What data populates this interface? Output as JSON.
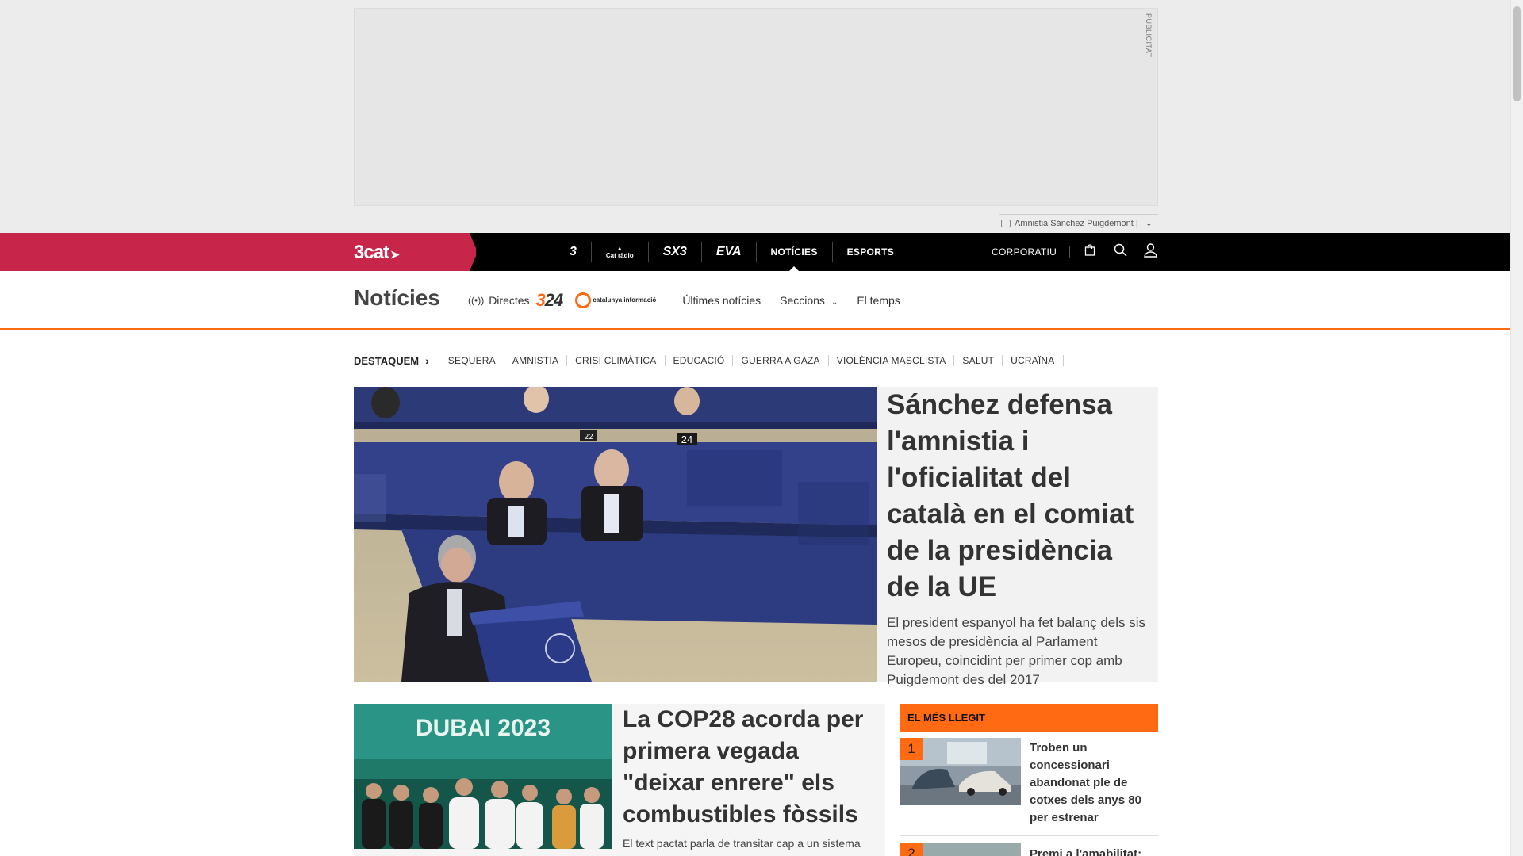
{
  "ad": {
    "label": "PUBLICITAT"
  },
  "tag_bar": {
    "text": "Amnistia Sánchez Puigdemont |",
    "chevron": "⌄"
  },
  "topbar": {
    "brand": "3cat",
    "channels": [
      {
        "label": "3",
        "kind": "tv3-logo"
      },
      {
        "label": "Cat ràdio",
        "kind": "catradio-logo"
      },
      {
        "label": "SX3",
        "kind": "sx3-logo"
      },
      {
        "label": "EVA",
        "kind": "eva-logo"
      },
      {
        "label": "NOTÍCIES",
        "kind": "text",
        "active": true
      },
      {
        "label": "ESPORTS",
        "kind": "text"
      }
    ],
    "corporate": "CORPORATIU",
    "icons": [
      "shopping-bag-icon",
      "search-icon",
      "user-icon"
    ]
  },
  "section": {
    "title": "Notícies",
    "directes": "Directes",
    "logo_324": "3/24",
    "logo_ci": "catalunya informació",
    "links": [
      "Últimes notícies",
      "Seccions",
      "El temps"
    ]
  },
  "destaquem": {
    "label": "DESTAQUEM",
    "topics": [
      "SEQUERA",
      "AMNISTIA",
      "CRISI CLIMÀTICA",
      "EDUCACIÓ",
      "GUERRA A GAZA",
      "VIOLÈNCIA MASCLISTA",
      "SALUT",
      "UCRAÏNA"
    ]
  },
  "lead": {
    "title": "Sánchez defensa l'amnistia i l'oficialitat del català en el comiat de la presidència de la UE",
    "subtitle": "El president espanyol ha fet balanç dels sis mesos de presidència al Parlament Europeu, coincidint per primer cop amb Puigdemont des del 2017",
    "image_desc_seat": "24",
    "image_desc_seat2": "22"
  },
  "second": {
    "title": "La COP28 acorda per primera vegada \"deixar enrere\" els combustibles fòssils",
    "subtitle": "El text pactat parla de transitar cap a un sistema",
    "image_text": "DUBAI 2023"
  },
  "most_read": {
    "header": "EL MÉS LLEGIT",
    "items": [
      {
        "rank": "1",
        "title": "Troben un concessionari abandonat ple de cotxes dels anys 80 per estrenar"
      },
      {
        "rank": "2",
        "title": "Premi a l'amabilitat:"
      }
    ]
  },
  "colors": {
    "brand": "#c8254b",
    "accent": "#ff6a13",
    "topbar": "#000000"
  }
}
